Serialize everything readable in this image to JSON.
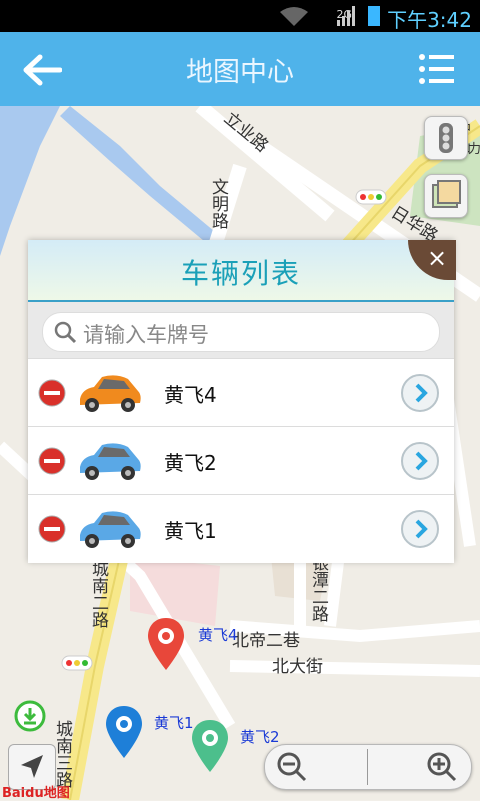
{
  "status_bar": {
    "network": "2G",
    "time": "下午3:42"
  },
  "header": {
    "title": "地图中心",
    "back_icon": "back-arrow-icon",
    "menu_icon": "list-menu-icon"
  },
  "map": {
    "roads": [
      "立业路",
      "文明路",
      "日华路",
      "城南二路",
      "北帝二巷",
      "北大街",
      "银潭二路",
      "城南三路"
    ],
    "partial_labels": [
      "中山",
      "力"
    ],
    "markers": [
      {
        "label": "黄飞4",
        "color": "#e8473a"
      },
      {
        "label": "黄飞1",
        "color": "#1e7fd8"
      },
      {
        "label": "黄飞2",
        "color": "#4cbf8c"
      }
    ],
    "logo": "Baidu地图"
  },
  "vehicle_panel": {
    "title": "车辆列表",
    "close_label": "×",
    "search_placeholder": "请输入车牌号",
    "vehicles": [
      {
        "plate": "黄飞4",
        "car_color": "#f08a1e"
      },
      {
        "plate": "黄飞2",
        "car_color": "#5aa8e6"
      },
      {
        "plate": "黄飞1",
        "car_color": "#5aa8e6"
      }
    ]
  },
  "colors": {
    "header": "#4fb3ea",
    "accent": "#1aa0b8",
    "delete": "#d9302a"
  }
}
